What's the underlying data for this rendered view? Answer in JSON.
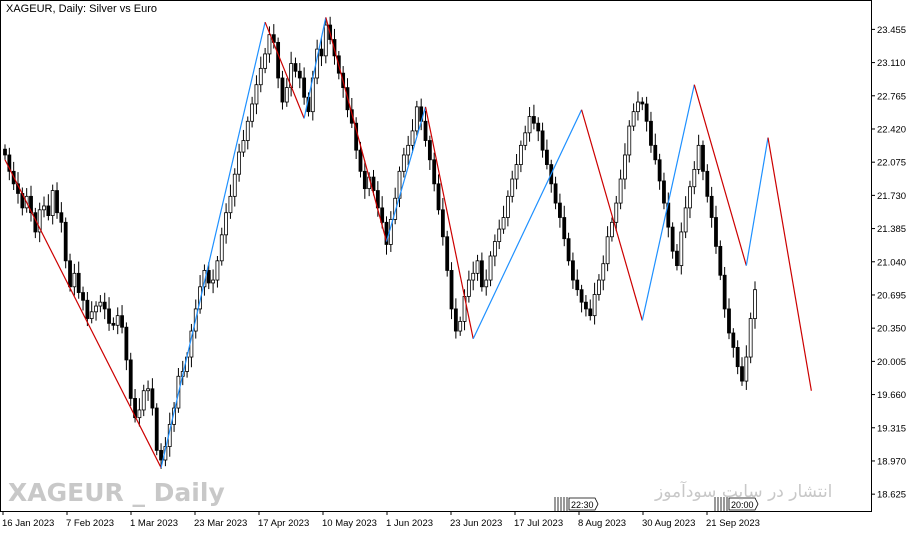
{
  "header": {
    "title": "XAGEUR, Daily:  Silver vs Euro"
  },
  "watermark": {
    "symbol_timeframe": "XAGEUR _ Daily",
    "site_text": "انتشار در سایت سودآموز"
  },
  "colors": {
    "bull": "#000000",
    "bear": "#000000",
    "zigzag_down": "#cc0000",
    "zigzag_up": "#1e90ff",
    "axis": "#000000"
  },
  "time_tags": [
    "22:30",
    "20:00"
  ],
  "chart_data": {
    "type": "candlestick",
    "title": "XAGEUR, Daily:  Silver vs Euro",
    "ylim": [
      18.45,
      23.75
    ],
    "y_ticks": [
      "23.455",
      "23.110",
      "22.765",
      "22.420",
      "22.075",
      "21.730",
      "21.385",
      "21.040",
      "20.695",
      "20.350",
      "20.005",
      "19.660",
      "19.315",
      "18.970",
      "18.625"
    ],
    "x_tick_labels": [
      "16 Jan 2023",
      "7 Feb 2023",
      "1 Mar 2023",
      "23 Mar 2023",
      "17 Apr 2023",
      "10 May 2023",
      "1 Jun 2023",
      "23 Jun 2023",
      "17 Jul 2023",
      "8 Aug 2023",
      "30 Aug 2023",
      "21 Sep 2023"
    ],
    "close": [
      22.15,
      21.98,
      21.85,
      21.75,
      21.6,
      21.72,
      21.55,
      21.35,
      21.58,
      21.62,
      21.52,
      21.78,
      21.55,
      21.45,
      21.05,
      20.78,
      20.92,
      20.72,
      20.64,
      20.45,
      20.52,
      20.58,
      20.62,
      20.55,
      20.4,
      20.38,
      20.48,
      20.36,
      20.02,
      19.62,
      19.42,
      19.5,
      19.7,
      19.72,
      19.52,
      19.08,
      18.98,
      19.12,
      19.35,
      19.52,
      19.85,
      19.9,
      20.05,
      20.32,
      20.55,
      20.78,
      20.95,
      20.82,
      20.85,
      21.05,
      21.32,
      21.55,
      21.72,
      21.95,
      22.18,
      22.3,
      22.5,
      22.68,
      22.88,
      23.05,
      23.2,
      23.4,
      23.32,
      22.95,
      22.7,
      22.85,
      23.1,
      23.02,
      22.95,
      22.75,
      22.6,
      22.95,
      23.25,
      23.18,
      23.5,
      23.35,
      23.18,
      23.0,
      22.85,
      22.62,
      22.48,
      22.2,
      21.98,
      21.8,
      21.92,
      21.78,
      21.6,
      21.45,
      21.22,
      21.48,
      21.7,
      21.98,
      22.15,
      22.25,
      22.4,
      22.65,
      22.5,
      22.3,
      22.1,
      21.85,
      21.58,
      21.3,
      20.95,
      20.55,
      20.32,
      20.42,
      20.68,
      20.85,
      20.92,
      21.05,
      20.78,
      20.85,
      21.1,
      21.25,
      21.38,
      21.5,
      21.72,
      21.9,
      22.05,
      22.25,
      22.38,
      22.55,
      22.48,
      22.4,
      22.2,
      22.05,
      21.85,
      21.65,
      21.5,
      21.28,
      21.05,
      20.85,
      20.75,
      20.62,
      20.55,
      20.48,
      20.7,
      20.85,
      21.02,
      21.3,
      21.45,
      21.65,
      21.9,
      22.15,
      22.45,
      22.6,
      22.7,
      22.68,
      22.5,
      22.25,
      22.1,
      21.88,
      21.65,
      21.4,
      21.15,
      21.0,
      21.35,
      21.6,
      21.82,
      22.0,
      22.25,
      21.98,
      21.72,
      21.5,
      21.2,
      20.9,
      20.55,
      20.3,
      20.15,
      19.95,
      19.8,
      20.05,
      20.45,
      20.75
    ],
    "volume": [],
    "zigzag": [
      {
        "index": 0,
        "price": 22.1
      },
      {
        "index": 36,
        "price": 18.9
      },
      {
        "index": 60,
        "price": 23.53
      },
      {
        "index": 69,
        "price": 22.53
      },
      {
        "index": 74,
        "price": 23.58
      },
      {
        "index": 88,
        "price": 21.25
      },
      {
        "index": 97,
        "price": 22.65
      },
      {
        "index": 108,
        "price": 20.24
      },
      {
        "index": 133,
        "price": 22.62
      },
      {
        "index": 147,
        "price": 20.43
      },
      {
        "index": 159,
        "price": 22.88
      },
      {
        "index": 171,
        "price": 21.0
      },
      {
        "index": 176,
        "price": 22.33
      },
      {
        "index": 186,
        "price": 19.7
      }
    ]
  }
}
